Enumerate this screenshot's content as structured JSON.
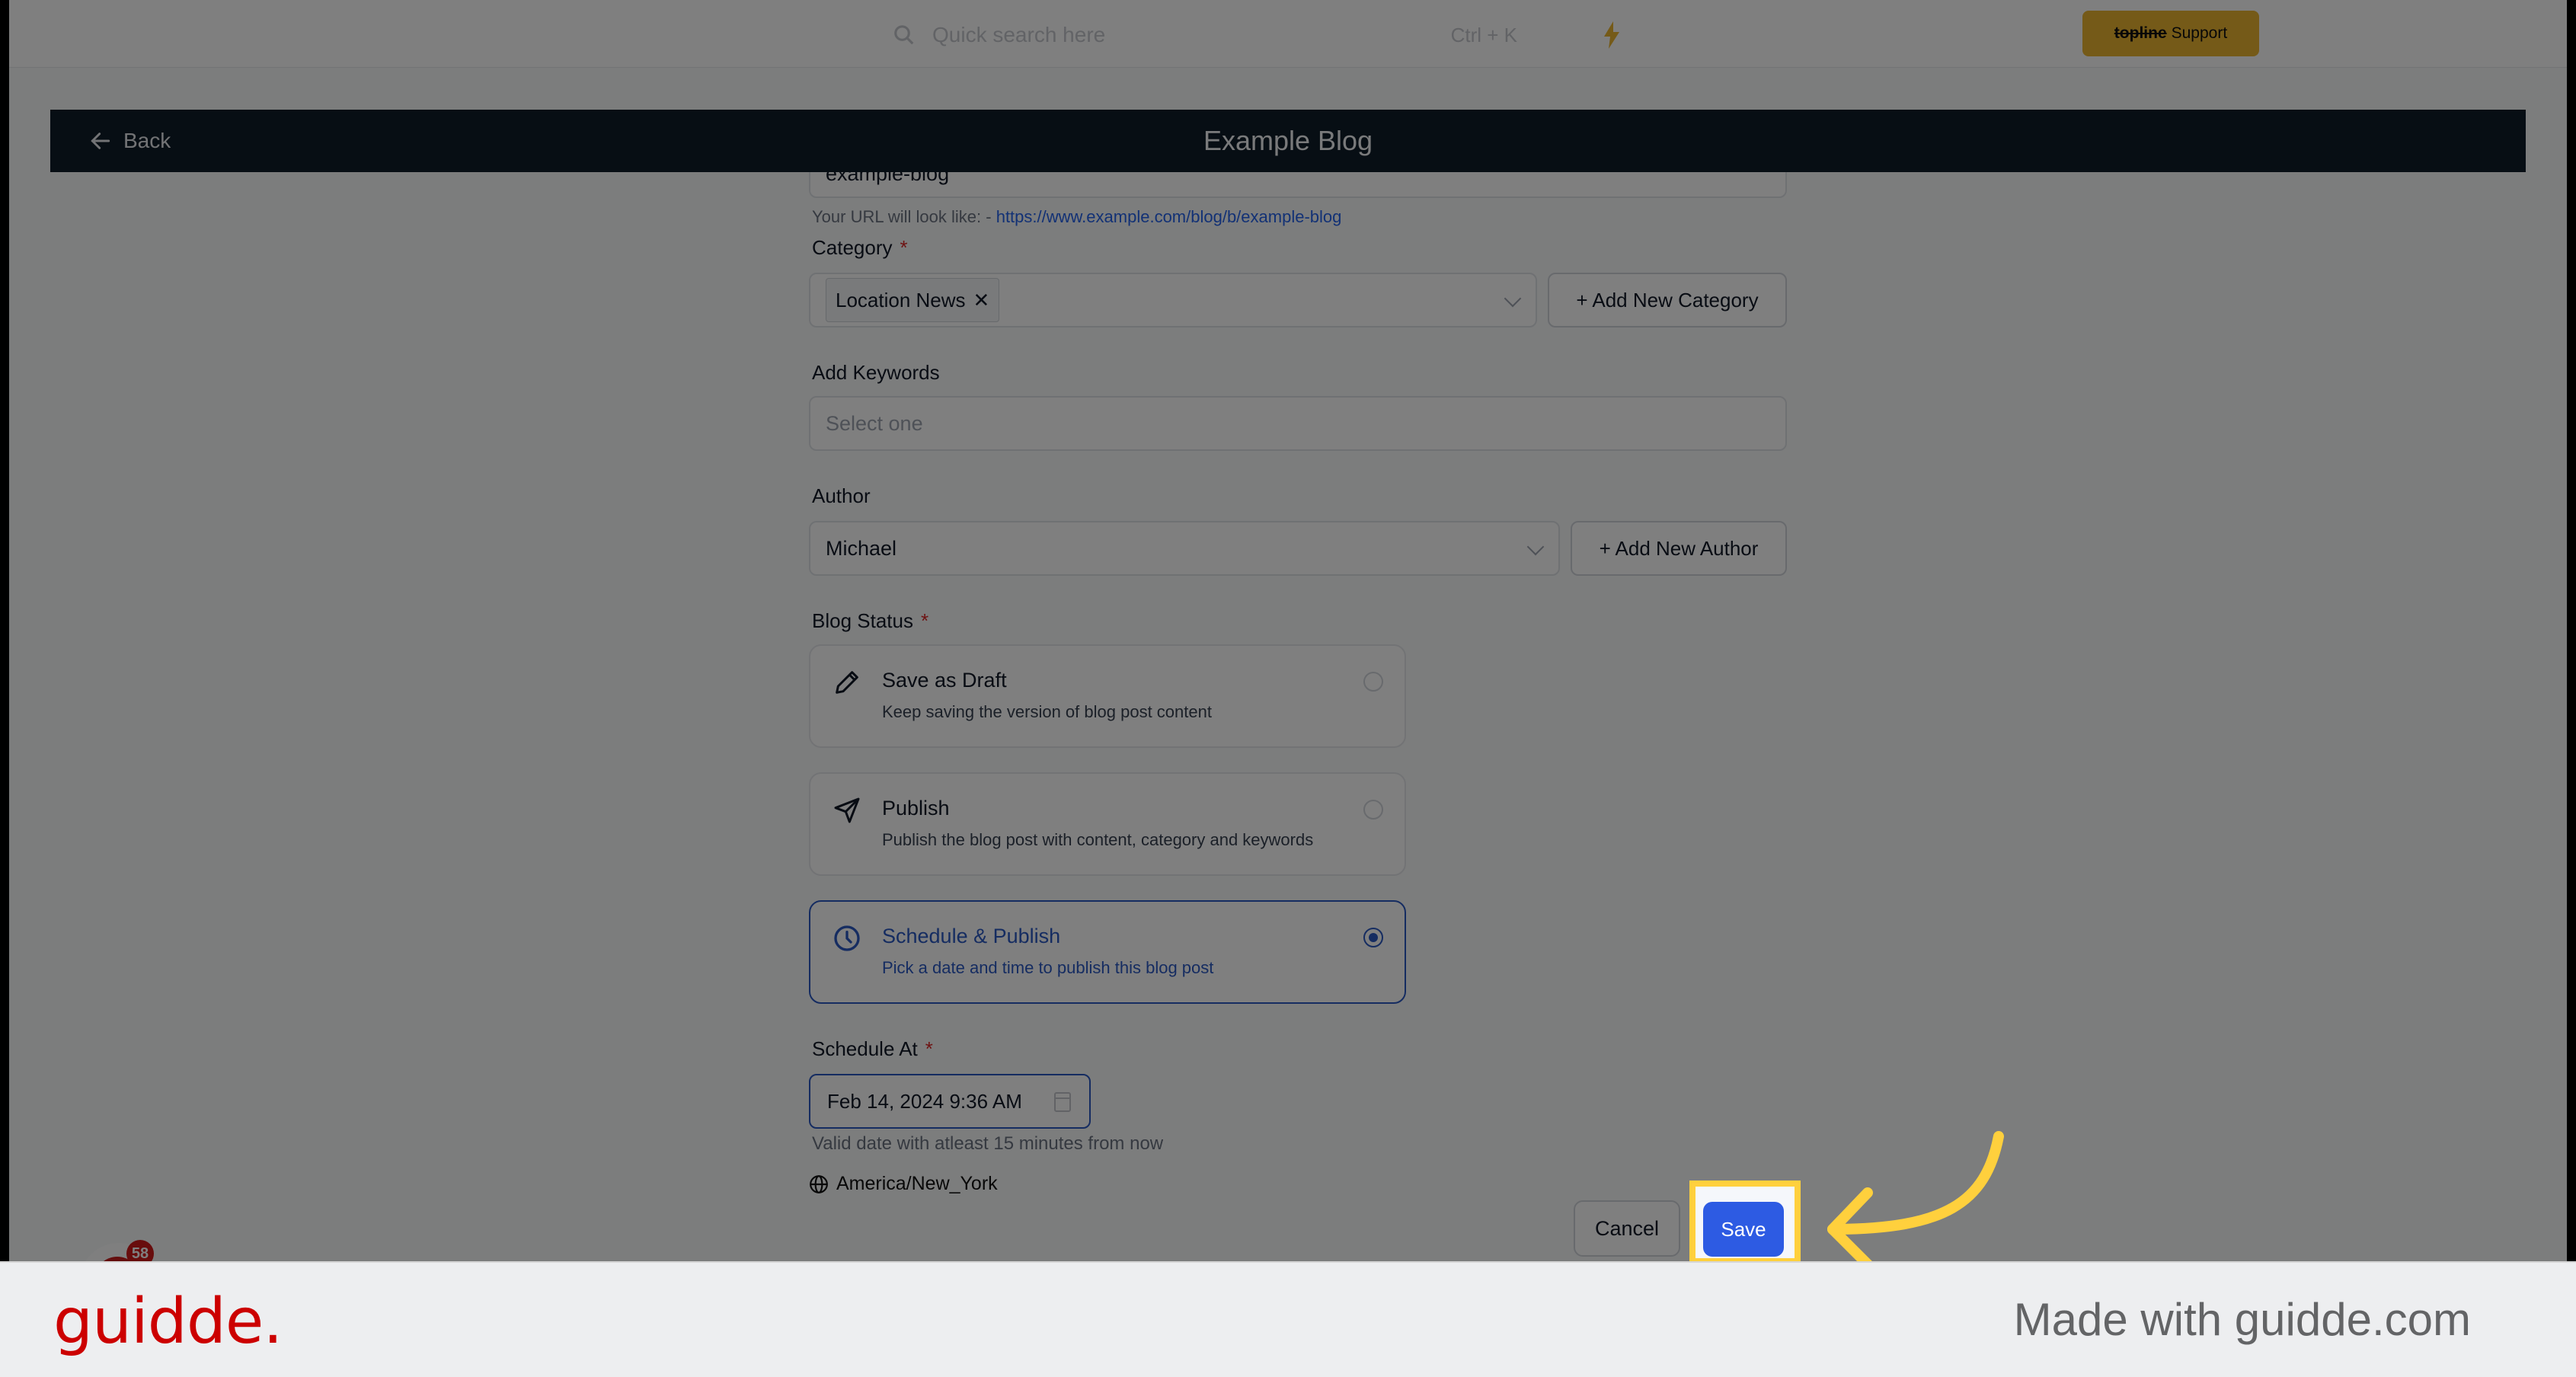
{
  "topbar": {
    "search_placeholder": "Quick search here",
    "search_shortcut": "Ctrl + K",
    "support_brand": "topline",
    "support_label": "Support"
  },
  "header": {
    "back_label": "Back",
    "title": "Example Blog"
  },
  "form": {
    "slug_value": "example-blog",
    "url_hint_prefix": "Your URL will look like: -",
    "url_hint_link": "https://www.example.com/blog/b/example-blog",
    "category": {
      "label": "Category",
      "required_mark": "*",
      "selected_chip": "Location News",
      "chip_remove": "✕",
      "add_button": "+ Add New Category"
    },
    "keywords": {
      "label": "Add Keywords",
      "placeholder": "Select one"
    },
    "author": {
      "label": "Author",
      "value": "Michael",
      "add_button": "+ Add New Author"
    },
    "blog_status": {
      "label": "Blog Status",
      "required_mark": "*",
      "options": [
        {
          "title": "Save as Draft",
          "description": "Keep saving the version of blog post content",
          "icon": "pencil-icon",
          "selected": false
        },
        {
          "title": "Publish",
          "description": "Publish the blog post with content, category and keywords",
          "icon": "send-icon",
          "selected": false
        },
        {
          "title": "Schedule & Publish",
          "description": "Pick a date and time to publish this blog post",
          "icon": "clock-icon",
          "selected": true
        }
      ]
    },
    "schedule": {
      "label": "Schedule At",
      "required_mark": "*",
      "value": "Feb 14, 2024 9:36 AM",
      "hint": "Valid date with atleast 15 minutes from now",
      "timezone": "America/New_York"
    },
    "actions": {
      "cancel_label": "Cancel",
      "save_label": "Save"
    }
  },
  "chat_widget": {
    "badge_count": "58"
  },
  "footer": {
    "logo_text": "guidde.",
    "made_with": "Made with guidde.com"
  },
  "colors": {
    "accent": "#2d5be3",
    "selected_border": "#2b59c3",
    "header_bg": "#0f1c28",
    "highlight": "#ffd03d",
    "support_bg": "#eab530",
    "brand_red": "#cc0000"
  }
}
